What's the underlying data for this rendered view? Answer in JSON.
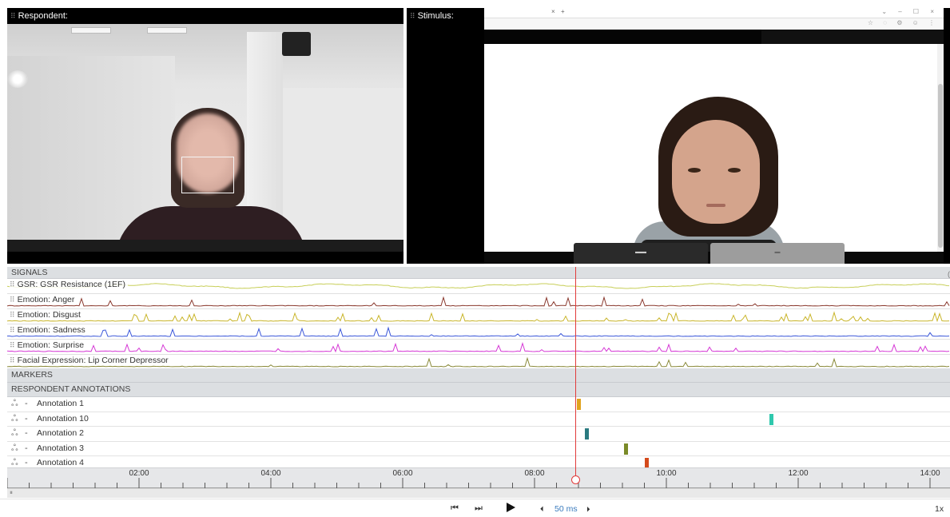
{
  "panels": {
    "respondent_title": "Respondent:",
    "stimulus_title": "Stimulus:"
  },
  "signals": {
    "header": "SIGNALS",
    "rows": [
      {
        "label": "GSR: GSR Resistance (1EF)",
        "color": "#c8cf5a"
      },
      {
        "label": "Emotion: Anger",
        "color": "#8b3a2f"
      },
      {
        "label": "Emotion: Disgust",
        "color": "#c9b52a"
      },
      {
        "label": "Emotion: Sadness",
        "color": "#3b57d9"
      },
      {
        "label": "Emotion: Surprise",
        "color": "#d63ad6"
      },
      {
        "label": "Facial Expression: Lip Corner Depressor",
        "color": "#8a8a3a"
      }
    ]
  },
  "markers": {
    "header": "MARKERS"
  },
  "respondent_annotations": {
    "header": "RESPONDENT ANNOTATIONS",
    "items": [
      {
        "label": "Annotation 1",
        "color": "#e0a31e",
        "time_s": 520
      },
      {
        "label": "Annotation 10",
        "color": "#2fc8ad",
        "time_s": 695
      },
      {
        "label": "Annotation 2",
        "color": "#2a7a80",
        "time_s": 527
      },
      {
        "label": "Annotation 3",
        "color": "#7a8a28",
        "time_s": 563
      },
      {
        "label": "Annotation 4",
        "color": "#d44a1c",
        "time_s": 582
      }
    ]
  },
  "timeline": {
    "labels": [
      "02:00",
      "04:00",
      "06:00",
      "08:00",
      "10:00",
      "12:00",
      "14:00"
    ],
    "playhead_s": 517
  },
  "transport": {
    "step_back_icon": "skip-back-icon",
    "step_forward_icon": "skip-forward-icon",
    "play_icon": "play-icon",
    "speed": "50 ms",
    "rate": "1x"
  },
  "colors": {
    "playhead": "#e23b3b",
    "accent": "#3a7bbd"
  }
}
